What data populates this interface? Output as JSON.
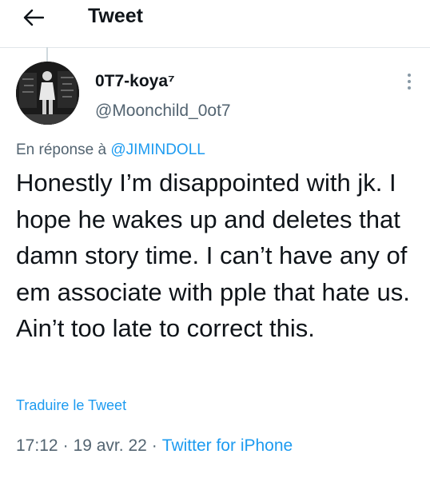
{
  "header": {
    "back_icon": "arrow-left-icon",
    "title": "Tweet"
  },
  "tweet": {
    "author": {
      "display_name": "0T7-koya⁷",
      "handle": "@Moonchild_0ot7",
      "avatar": "avatar-photo"
    },
    "more_icon": "vertical-dots-icon",
    "reply_prefix": "En réponse à",
    "reply_mention": "@JIMINDOLL",
    "text": "Honestly I’m disappointed with jk. I hope he wakes up and deletes that damn story time. I can’t have any of em associate with pple that hate us. Ain’t too late to correct this.",
    "translate_label": "Traduire le Tweet",
    "time": "17:12",
    "date": "19 avr. 22",
    "separator": "·",
    "source": "Twitter for iPhone"
  },
  "colors": {
    "text": "#0f1419",
    "secondary": "#536471",
    "link": "#1d9bf0",
    "divider": "#e1e6ea"
  }
}
